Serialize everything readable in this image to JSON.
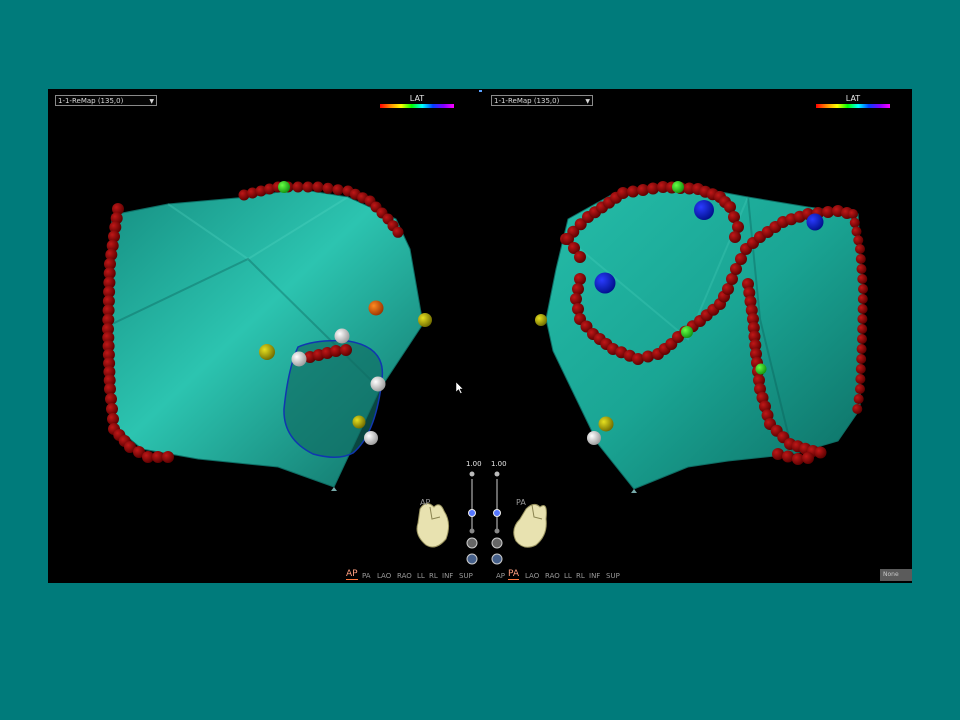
{
  "viewports": {
    "left": {
      "map_name": "1-1-ReMap (135,0)",
      "legend_label": "LAT",
      "orientation_label": "AP"
    },
    "right": {
      "map_name": "1-1-ReMap (135,0)",
      "legend_label": "LAT",
      "orientation_label": "PA"
    }
  },
  "opacity": {
    "left": "1.00",
    "right": "1.00"
  },
  "view_buttons": {
    "left": [
      {
        "label": "AP",
        "active": true
      },
      {
        "label": "PA"
      },
      {
        "label": "LAO"
      },
      {
        "label": "RAO"
      },
      {
        "label": "LL"
      },
      {
        "label": "RL"
      },
      {
        "label": "INF"
      },
      {
        "label": "SUP"
      }
    ],
    "right": [
      {
        "label": "AP"
      },
      {
        "label": "PA",
        "active": true
      },
      {
        "label": "LAO"
      },
      {
        "label": "RAO"
      },
      {
        "label": "LL"
      },
      {
        "label": "RL"
      },
      {
        "label": "INF"
      },
      {
        "label": "SUP"
      }
    ]
  },
  "none_button": "None",
  "colors": {
    "slide_background": "#007b7b",
    "viewer_background": "#000000",
    "surface": "#1fb5a3",
    "ablation_tag": "#8b0000",
    "accent_underline": "#ff7a3d"
  }
}
